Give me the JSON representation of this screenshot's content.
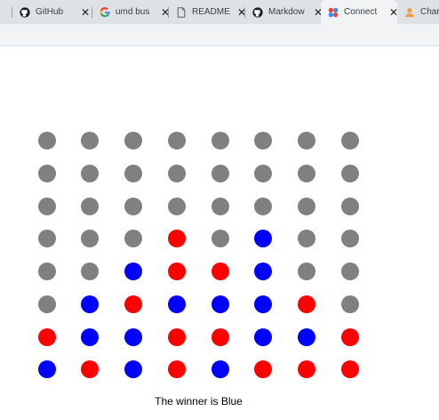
{
  "tabs": [
    {
      "title": "",
      "icon": "close-icon-partial",
      "active": false
    },
    {
      "title": "GitHub",
      "icon": "github-icon",
      "active": false
    },
    {
      "title": "umd bus",
      "icon": "google-icon",
      "active": false
    },
    {
      "title": "README",
      "icon": "document-icon",
      "active": false
    },
    {
      "title": "Markdow",
      "icon": "github-icon",
      "active": false
    },
    {
      "title": "Connect",
      "icon": "app-logo-icon",
      "active": true
    },
    {
      "title": "Char",
      "icon": "user-icon",
      "active": false
    }
  ],
  "colors": {
    "empty": "#808080",
    "red": "#ff0000",
    "blue": "#0000ff"
  },
  "board": {
    "rows": [
      [
        "empty",
        "empty",
        "empty",
        "empty",
        "empty",
        "empty",
        "empty",
        "empty"
      ],
      [
        "empty",
        "empty",
        "empty",
        "empty",
        "empty",
        "empty",
        "empty",
        "empty"
      ],
      [
        "empty",
        "empty",
        "empty",
        "empty",
        "empty",
        "empty",
        "empty",
        "empty"
      ],
      [
        "empty",
        "empty",
        "empty",
        "red",
        "empty",
        "blue",
        "empty",
        "empty"
      ],
      [
        "empty",
        "empty",
        "blue",
        "red",
        "red",
        "blue",
        "empty",
        "empty"
      ],
      [
        "empty",
        "blue",
        "red",
        "blue",
        "blue",
        "blue",
        "red",
        "empty"
      ],
      [
        "red",
        "blue",
        "blue",
        "red",
        "red",
        "blue",
        "blue",
        "red"
      ],
      [
        "blue",
        "red",
        "blue",
        "red",
        "blue",
        "red",
        "red",
        "red"
      ]
    ]
  },
  "status": "The winner is Blue"
}
